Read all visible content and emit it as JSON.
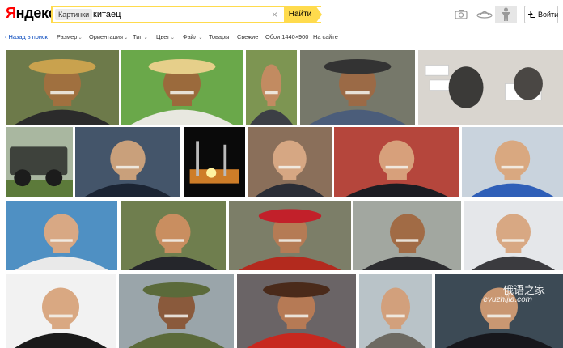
{
  "header": {
    "logo": "Яндекс",
    "search_tag": "Картинки",
    "query": "китаец",
    "clear": "×",
    "find_label": "Найти",
    "login_label": "Войти",
    "icons": [
      "camera-icon",
      "ufo-icon",
      "person-icon",
      "door-icon"
    ]
  },
  "filters": {
    "back": "‹ Назад в поиск",
    "size": "Размер",
    "orientation": "Ориентация",
    "type": "Тип",
    "color": "Цвет",
    "file": "Файл",
    "goods": "Товары",
    "fresh": "Свежие",
    "wallpaper": "Обои 1440×900",
    "on_site": "На сайте"
  },
  "results": {
    "rows": [
      [
        "elderly man in straw conical hat",
        "smiling man with cigarette in straw hat",
        "old man with white beard",
        "laughing man in cap",
        "husky dog with white boxes"
      ],
      [
        "military off-road vehicle",
        "officer at computer console",
        "rocket launch at night",
        "man in glasses and suit",
        "smiling man in glasses",
        "young man in blue shirt pointing"
      ],
      [
        "young man portrait",
        "laughing man in dark suit",
        "old man in red ethnic headdress",
        "man at car window",
        "young man with peace sign"
      ],
      [
        "young man in black shirt",
        "old man with army cap and goggles",
        "old man with fur hat and pipe",
        "man with round glasses",
        "man in dark suit"
      ]
    ],
    "watermark_cn": "俄语之家",
    "watermark_url": "eyuzhijia.com"
  },
  "colors": {
    "brand_red": "#ff0000",
    "search_yellow": "#ffdb4d",
    "link_blue": "#0044bb"
  }
}
